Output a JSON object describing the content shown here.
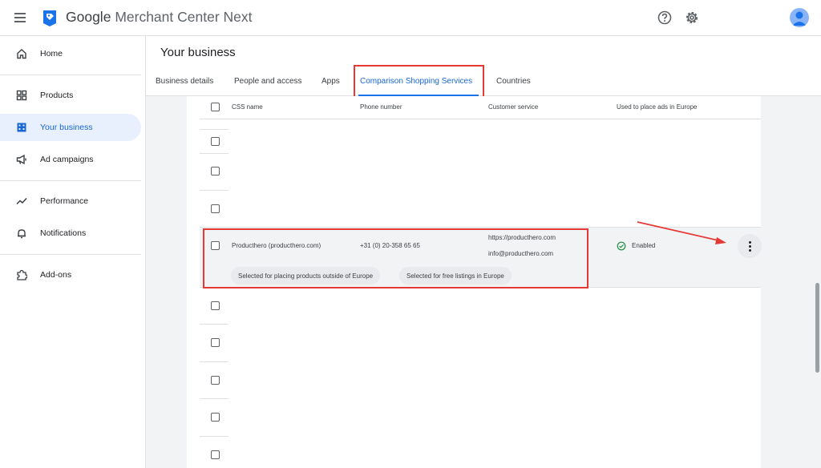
{
  "topbar": {
    "brand_google": "Google",
    "brand_product": "Merchant Center Next"
  },
  "sidebar": {
    "items": [
      {
        "label": "Home"
      },
      {
        "label": "Products"
      },
      {
        "label": "Your business"
      },
      {
        "label": "Ad campaigns"
      },
      {
        "label": "Performance"
      },
      {
        "label": "Notifications"
      },
      {
        "label": "Add-ons"
      }
    ]
  },
  "header": {
    "title": "Your business",
    "tabs": [
      {
        "label": "Business details"
      },
      {
        "label": "People and access"
      },
      {
        "label": "Apps"
      },
      {
        "label": "Comparison Shopping Services"
      },
      {
        "label": "Countries"
      }
    ]
  },
  "table": {
    "columns": [
      "CSS name",
      "Phone number",
      "Customer service",
      "Used to place ads in Europe"
    ],
    "highlighted_row": {
      "css_name": "Producthero (producthero.com)",
      "phone": "+31 (0) 20-358 65 65",
      "customer_service_url": "https://producthero.com",
      "customer_service_email": "info@producthero.com",
      "status": "Enabled",
      "tags": [
        "Selected for placing products outside of Europe",
        "Selected for free listings in Europe"
      ]
    }
  },
  "colors": {
    "accent": "#1a73e8",
    "annotation": "#e53935",
    "status_ok": "#1e8e3e"
  }
}
